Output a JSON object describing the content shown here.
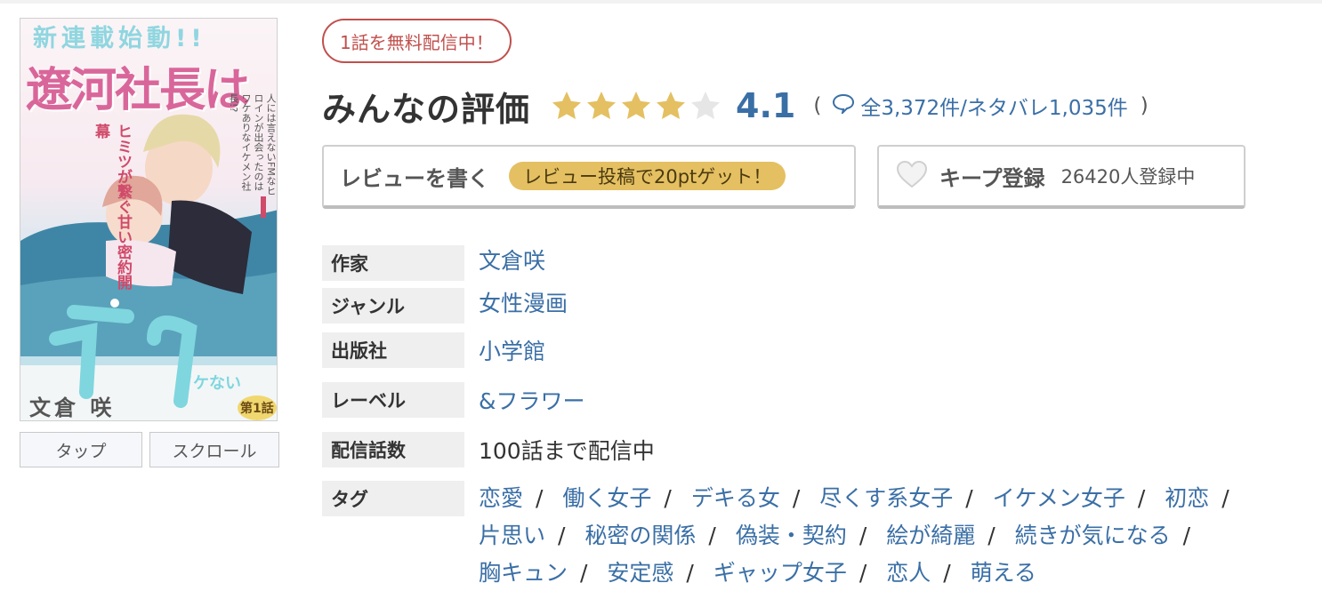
{
  "cover": {
    "title_top": "新連載始動!!",
    "title_main": "遼河社長は",
    "title_sub": "イケない",
    "author_on_cover": "文倉 咲",
    "episode_badge": "第1話",
    "tagline_left": "ヒミツが繋ぐ甘い密約開幕",
    "tagline_right": "人には言えないFMなヒロインが出会ったのはワケありなイケメン社長!?",
    "tap_label": "タップ",
    "scroll_label": "スクロール"
  },
  "free_badge": "1話を無料配信中！",
  "rating": {
    "title": "みんなの評価",
    "score": "4.1",
    "stars_filled": 4,
    "stars_total": 5,
    "open_paren": "(",
    "counts": "全3,372件/ネタバレ1,035件",
    "close_paren": ")",
    "star_color": "#e4c062",
    "star_empty_color": "#e6e6e6"
  },
  "review_button": {
    "label": "レビューを書く",
    "badge": "レビュー投稿で20ptゲット！"
  },
  "keep_button": {
    "label": "キープ登録",
    "count": "26420人登録中"
  },
  "info": [
    {
      "label": "作家",
      "value": "文倉咲",
      "link": true
    },
    {
      "label": "ジャンル",
      "value": "女性漫画",
      "link": true
    },
    {
      "label": "出版社",
      "value": "小学館",
      "link": true
    },
    {
      "label": "レーベル",
      "value": "&フラワー",
      "link": true
    },
    {
      "label": "配信話数",
      "value": "100話まで配信中",
      "link": false
    },
    {
      "label": "タグ"
    }
  ],
  "tags": [
    "恋愛",
    "働く女子",
    "デキる女",
    "尽くす系女子",
    "イケメン女子",
    "初恋",
    "片思い",
    "秘密の関係",
    "偽装・契約",
    "絵が綺麗",
    "続きが気になる",
    "胸キュン",
    "安定感",
    "ギャップ女子",
    "恋人",
    "萌える"
  ],
  "colors": {
    "link": "#3a6fa6",
    "badge_red": "#c0504d",
    "badge_gold": "#e4c062"
  }
}
